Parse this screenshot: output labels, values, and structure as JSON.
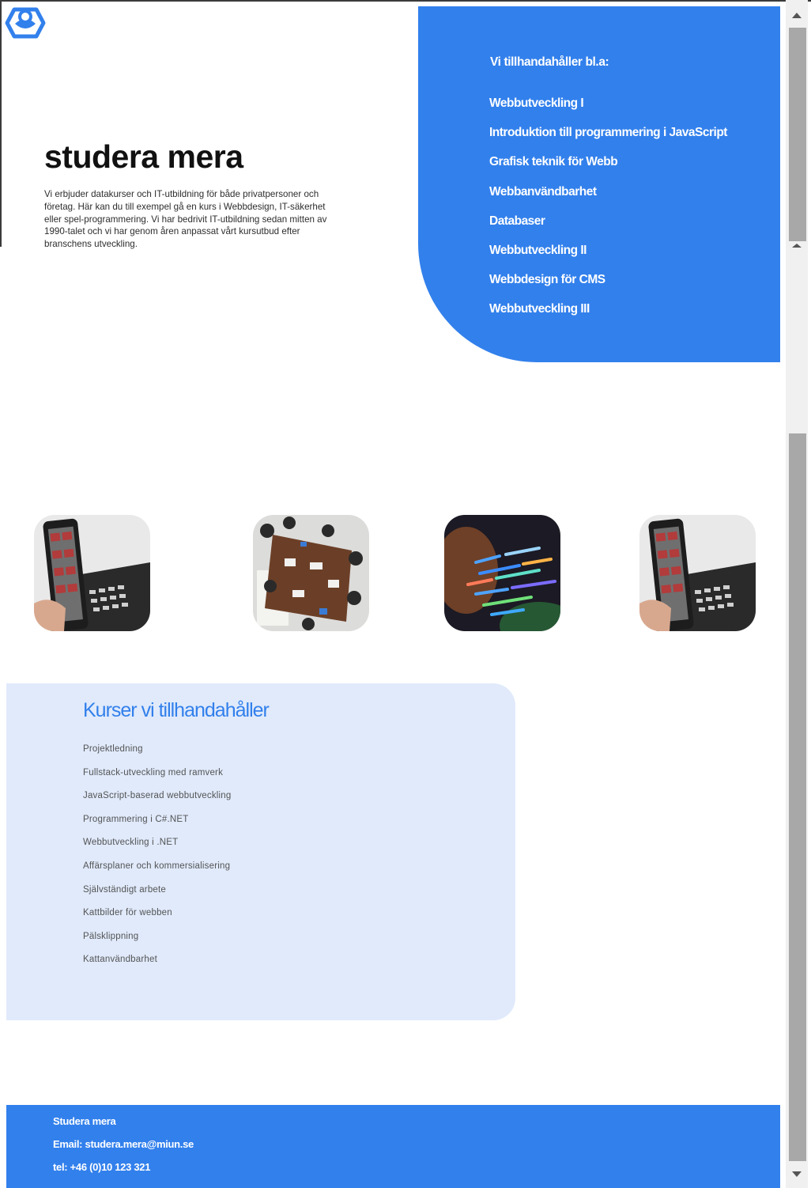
{
  "hero": {
    "title": "studera mera",
    "description": "Vi erbjuder datakurser och IT-utbildning för både privatpersoner och företag. Här kan du till exempel gå en kurs i Webbdesign, IT-säkerhet eller spel-programmering. Vi har bedrivit IT-utbildning sedan mitten av 1990-talet och vi har genom åren anpassat vårt kursutbud efter branschens utveckling."
  },
  "provide_panel": {
    "heading": "Vi tillhandahåller bl.a:",
    "items": [
      "Webbutveckling I",
      "Introduktion till programmering i JavaScript",
      "Grafisk teknik för Webb",
      "Webbanvändbarhet",
      "Databaser",
      "Webbutveckling II",
      "Webbdesign för CMS",
      "Webbutveckling III"
    ]
  },
  "courses": {
    "heading": "Kurser vi tillhandahåller",
    "items": [
      "Projektledning",
      "Fullstack-utveckling med ramverk",
      "JavaScript-baserad webbutveckling",
      "Programmering i C#.NET",
      "Webbutveckling i .NET",
      "Affärsplaner och kommersialisering",
      "Självständigt arbete",
      "Kattbilder för webben",
      "Pälsklippning",
      "Kattanvändbarhet"
    ]
  },
  "footer": {
    "name": "Studera mera",
    "email": "Email: studera.mera@miun.se",
    "phone": "tel: +46 (0)10 123 321"
  },
  "colors": {
    "accent": "#3280ec",
    "card_background": "#e0eafb"
  },
  "images": [
    {
      "icon": "phone-in-hand-photo"
    },
    {
      "icon": "meeting-table-photo"
    },
    {
      "icon": "code-screen-photo"
    },
    {
      "icon": "phone-in-hand-photo"
    }
  ]
}
